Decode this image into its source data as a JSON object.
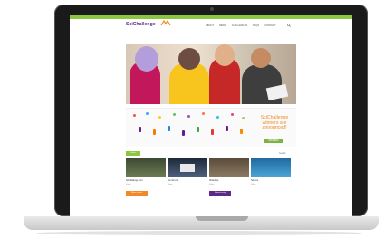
{
  "site": {
    "logo_text": "SciChallenge",
    "nav": [
      "ABOUT",
      "NEWS",
      "CHALLENGES",
      "FAQS",
      "CONTACT"
    ]
  },
  "banner": {
    "headline_lines": [
      "SciChallenge",
      "winners are",
      "announced!"
    ],
    "button": "WINNERS"
  },
  "videos": {
    "section": "Videos",
    "more": "See all",
    "items": [
      {
        "title": "SciChallenge intro",
        "meta": "Video"
      },
      {
        "title": "Our lab visit",
        "meta": "Video"
      },
      {
        "title": "Workshop",
        "meta": "Video"
      },
      {
        "title": "Science",
        "meta": "Video"
      }
    ],
    "buttons": [
      "More videos",
      "Submit entry"
    ]
  },
  "colors": {
    "brand_green": "#8cc63f",
    "brand_orange": "#f08a24",
    "brand_purple": "#5b2a86"
  }
}
